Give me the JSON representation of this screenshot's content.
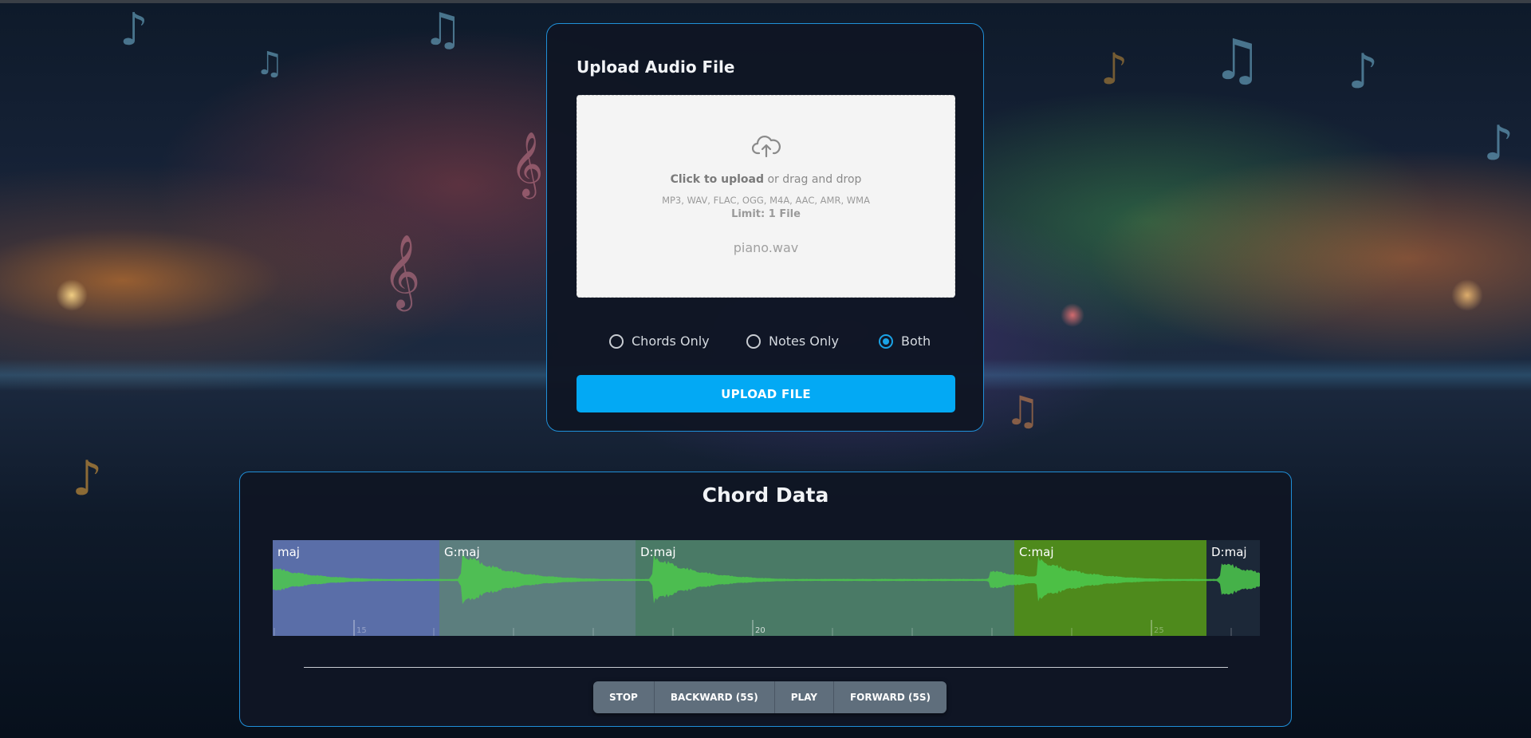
{
  "upload": {
    "title": "Upload Audio File",
    "dropzone": {
      "click_text": "Click to upload",
      "drag_text": "or drag and drop",
      "formats": "MP3, WAV, FLAC, OGG, M4A, AAC, AMR, WMA",
      "limit": "Limit: 1 File",
      "file_name": "piano.wav",
      "icon": "cloud-upload-icon"
    },
    "options": [
      {
        "label": "Chords Only",
        "selected": false
      },
      {
        "label": "Notes Only",
        "selected": false
      },
      {
        "label": "Both",
        "selected": true
      }
    ],
    "button_label": "UPLOAD FILE"
  },
  "chord_data": {
    "title": "Chord Data",
    "regions": [
      {
        "label": "maj",
        "color": "#5a6ea8"
      },
      {
        "label": "G:maj",
        "color": "#5c7e7e"
      },
      {
        "label": "D:maj",
        "color": "#4a7a66"
      },
      {
        "label": "C:maj",
        "color": "#4e8a1c"
      },
      {
        "label": "D:maj",
        "color": "#1c2838"
      }
    ],
    "ticks": [
      "15",
      "20",
      "25"
    ],
    "controls": {
      "stop": "STOP",
      "backward": "BACKWARD (5S)",
      "play": "PLAY",
      "forward": "FORWARD (5S)"
    }
  },
  "colors": {
    "accent": "#03a9f4",
    "card_border": "#1f8fd8",
    "wave": "#4cc94c"
  }
}
